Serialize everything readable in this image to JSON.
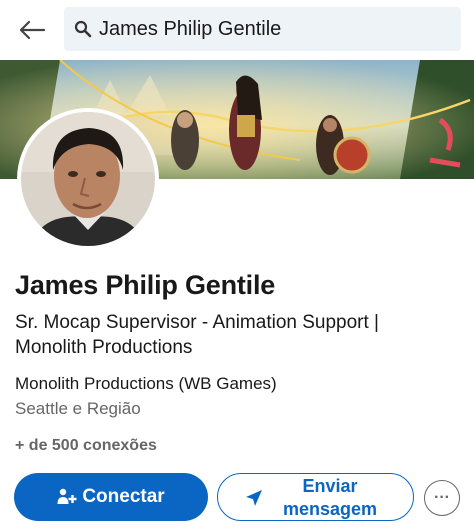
{
  "topbar": {
    "back_icon": "arrow-left-icon",
    "search": {
      "icon": "search-icon",
      "query": "James Philip Gentile"
    }
  },
  "profile": {
    "name": "James Philip Gentile",
    "headline": "Sr. Mocap Supervisor - Animation Support | Monolith Productions",
    "company": "Monolith Productions (WB Games)",
    "location": "Seattle e Região",
    "connections": "+ de 500 conexões"
  },
  "actions": {
    "connect": {
      "label": "Conectar",
      "icon": "add-person-icon"
    },
    "message": {
      "label": "Enviar mensagem",
      "icon": "send-icon"
    },
    "more": {
      "icon": "more-horizontal-icon",
      "label": "···"
    }
  },
  "colors": {
    "primary": "#0a66c2",
    "text": "#191919",
    "muted": "#666666",
    "search_bg": "#eef3f8"
  }
}
